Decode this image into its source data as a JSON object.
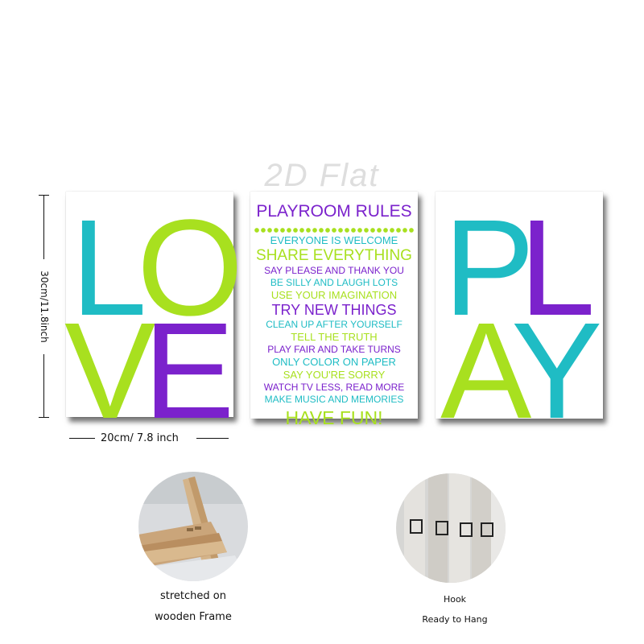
{
  "colors": {
    "teal": "#1fbcc4",
    "lime": "#a8e01f",
    "purple": "#7b22cc"
  },
  "watermark": "2D Flat",
  "love_panel": {
    "L": "L",
    "O": "O",
    "V": "V",
    "E": "E"
  },
  "play_panel": {
    "P": "P",
    "L": "L",
    "A": "A",
    "Y": "Y"
  },
  "rules_panel": {
    "title": "PLAYROOM RULES",
    "lines": [
      {
        "text": "EVERYONE IS WELCOME",
        "color": "#1fbcc4"
      },
      {
        "text": "SHARE EVERYTHING",
        "color": "#a8e01f"
      },
      {
        "text": "SAY PLEASE AND THANK YOU",
        "color": "#7b22cc"
      },
      {
        "text": "BE SILLY AND LAUGH LOTS",
        "color": "#1fbcc4"
      },
      {
        "text": "USE YOUR IMAGINATION",
        "color": "#a8e01f"
      },
      {
        "text": "TRY NEW THINGS",
        "color": "#7b22cc"
      },
      {
        "text": "CLEAN UP AFTER YOURSELF",
        "color": "#1fbcc4"
      },
      {
        "text": "TELL THE TRUTH",
        "color": "#a8e01f"
      },
      {
        "text": "PLAY FAIR AND TAKE TURNS",
        "color": "#7b22cc"
      },
      {
        "text": "ONLY COLOR ON PAPER",
        "color": "#1fbcc4"
      },
      {
        "text": "SAY YOU'RE SORRY",
        "color": "#a8e01f"
      },
      {
        "text": "WATCH TV LESS, READ MORE",
        "color": "#7b22cc"
      },
      {
        "text": "MAKE MUSIC AND MEMORIES",
        "color": "#1fbcc4"
      },
      {
        "text": "HAVE FUN!",
        "color": "#a8e01f"
      }
    ]
  },
  "dimensions": {
    "height_label": "30cm/11.8inch",
    "width_label": "20cm/ 7.8 inch"
  },
  "captions": {
    "frame_line1": "stretched on",
    "frame_line2": "wooden Frame",
    "hook_line1": "Hook",
    "hook_line2": "Ready to Hang"
  }
}
